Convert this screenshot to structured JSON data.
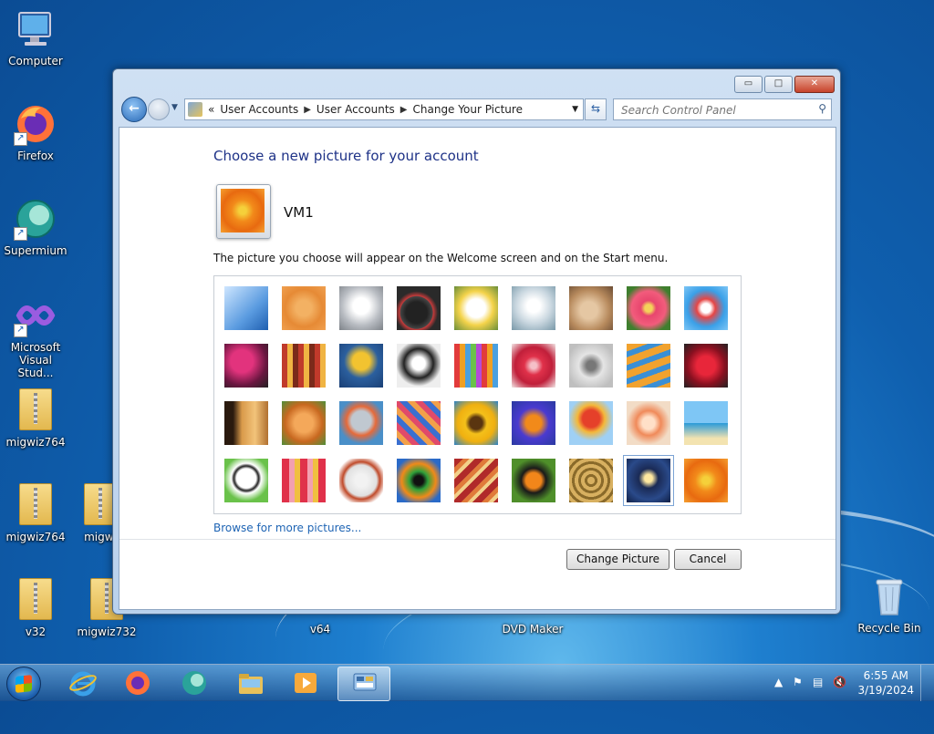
{
  "desktop": {
    "icons": [
      {
        "label": "Computer"
      },
      {
        "label": "Firefox"
      },
      {
        "label": "Supermium"
      },
      {
        "label": "Microsoft Visual Stud..."
      },
      {
        "label": "migwiz764"
      },
      {
        "label": "migwiz764"
      },
      {
        "label": "migwi"
      },
      {
        "label": "v32"
      },
      {
        "label": "migwiz732"
      },
      {
        "label": "v64"
      },
      {
        "label": "DVD Maker"
      },
      {
        "label": "Recycle Bin"
      }
    ]
  },
  "window": {
    "controls": {
      "minimize": "▭",
      "maximize": "□",
      "close": "✕"
    },
    "address": {
      "prefix": "«",
      "crumbs": [
        "User Accounts",
        "User Accounts",
        "Change Your Picture"
      ]
    },
    "search": {
      "placeholder": "Search Control Panel"
    },
    "heading": "Choose a new picture for your account",
    "username": "VM1",
    "description": "The picture you choose will appear on the Welcome screen and on the Start menu.",
    "pictures": [
      "roller-coaster",
      "starfish",
      "robot-toy",
      "record-player",
      "lucky-cat",
      "gyroscope",
      "kitten",
      "pink-flower",
      "ferris-wheel",
      "ball",
      "fabric",
      "yellow-leaf",
      "dog",
      "crayons",
      "star-ornament",
      "jacks",
      "stairs",
      "paper-crane",
      "guitar",
      "pomeranian",
      "tin-robot",
      "scarves",
      "sunflower",
      "fish",
      "hot-air-balloon",
      "doll",
      "sailboat",
      "soccer-ball",
      "textile",
      "marbles",
      "window",
      "rug",
      "butterfly",
      "shell",
      "lantern",
      "orange-flower"
    ],
    "selected_index": 34,
    "browse_link": "Browse for more pictures...",
    "buttons": {
      "change": "Change Picture",
      "cancel": "Cancel"
    }
  },
  "taskbar": {
    "items": [
      "start",
      "internet-explorer",
      "firefox",
      "supermium",
      "file-explorer",
      "media-player",
      "control-panel"
    ],
    "clock": {
      "time": "6:55 AM",
      "date": "3/19/2024"
    }
  }
}
